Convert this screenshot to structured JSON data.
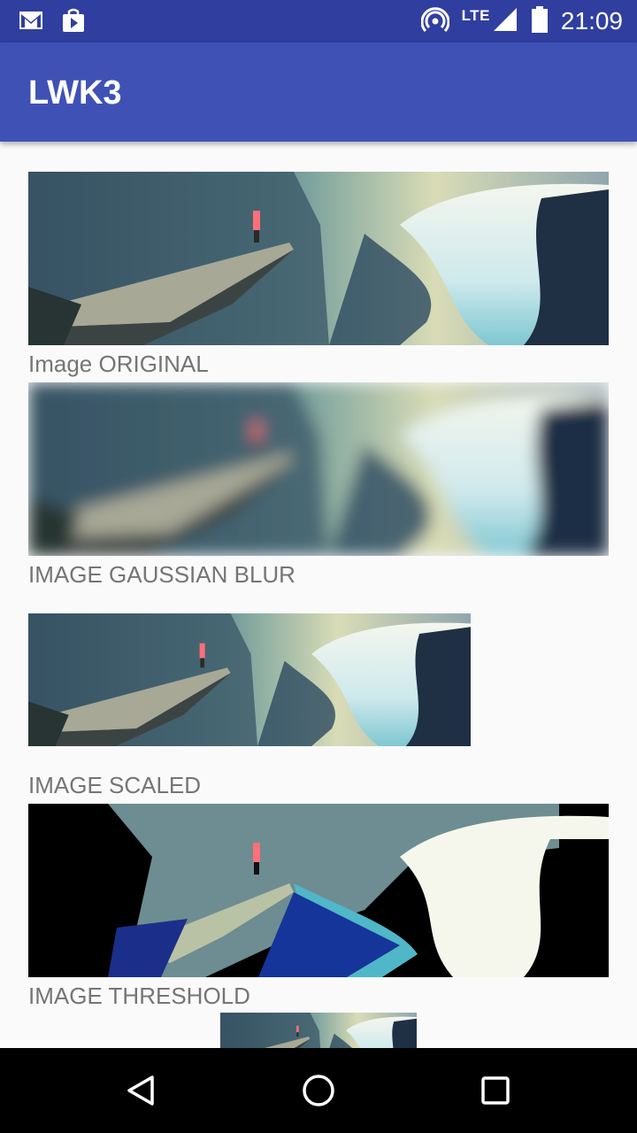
{
  "status_bar": {
    "left_icons": [
      "gmail-icon",
      "play-store-icon"
    ],
    "right_icons": [
      "hotspot-icon",
      "signal-icon",
      "battery-icon"
    ],
    "network": "LTE",
    "time": "21:09"
  },
  "app_bar": {
    "title": "LWK3"
  },
  "images": [
    {
      "caption": "Image ORIGINAL"
    },
    {
      "caption": "IMAGE GAUSSIAN BLUR"
    },
    {
      "caption": "IMAGE SCALED"
    },
    {
      "caption": "IMAGE THRESHOLD"
    },
    {
      "caption": ""
    }
  ],
  "nav_bar": {
    "buttons": [
      "back-icon",
      "home-icon",
      "recents-icon"
    ]
  },
  "colors": {
    "primary": "#3f51b5",
    "primary_dark": "#303f9f",
    "caption_text": "#757575",
    "background": "#fafafa"
  }
}
